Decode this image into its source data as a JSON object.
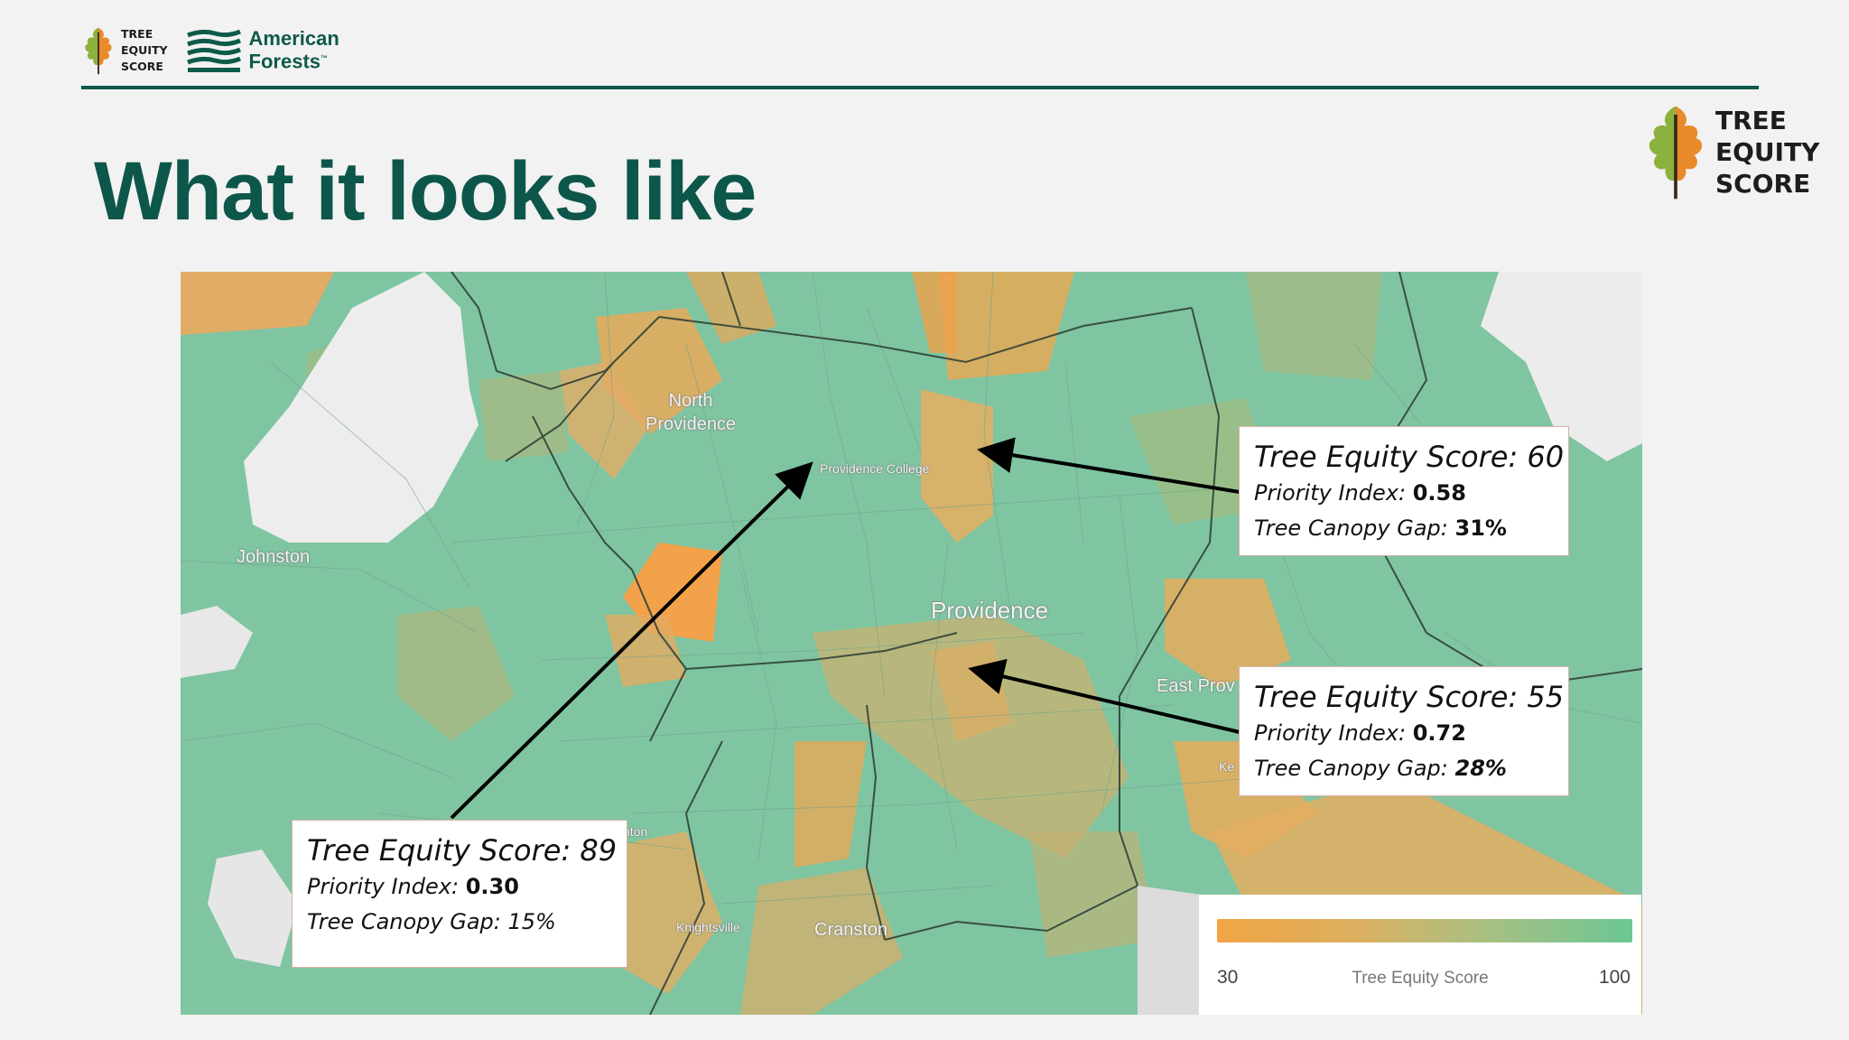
{
  "header": {
    "small_logo_lines": [
      "TREE",
      "EQUITY",
      "SCORE"
    ],
    "brand_lines": [
      "American",
      "Forests"
    ],
    "brand_tm": "™"
  },
  "slide": {
    "title": "What it looks like",
    "logo_lines": [
      "TREE",
      "EQUITY",
      "SCORE"
    ]
  },
  "map": {
    "places": {
      "north_providence": [
        "North",
        "Providence"
      ],
      "providence_college": "Providence College",
      "johnston": "Johnston",
      "providence": "Providence",
      "east_providence": "East Prov",
      "kent": "Ke",
      "cranston": "Cranston",
      "knightsville": "Knightsville",
      "anton": "nton"
    },
    "callouts": [
      {
        "score_label": "Tree Equity Score:",
        "score": "60",
        "priority_label": "Priority Index:",
        "priority": "0.58",
        "gap_label": "Tree Canopy Gap:",
        "gap": "31%"
      },
      {
        "score_label": "Tree Equity Score:",
        "score": "55",
        "priority_label": "Priority Index:",
        "priority": "0.72",
        "gap_label": "Tree Canopy Gap:",
        "gap": "28%"
      },
      {
        "score_label": "Tree Equity Score:",
        "score": "89",
        "priority_label": "Priority Index:",
        "priority": "0.30",
        "gap_label": "Tree Canopy Gap:",
        "gap": "15%"
      }
    ],
    "legend": {
      "min": "30",
      "max": "100",
      "title": "Tree Equity Score",
      "low_color": "#f2a444",
      "high_color": "#6cc694"
    }
  },
  "colors": {
    "brand_green": "#0d564a",
    "score_low": "#f2a444",
    "score_high": "#6cc694"
  }
}
